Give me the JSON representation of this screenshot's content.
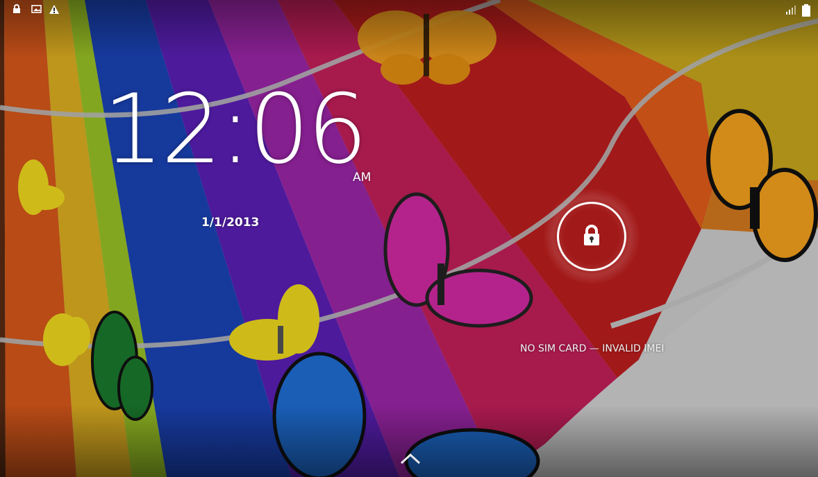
{
  "screen": {
    "name": "android-lockscreen"
  },
  "status_bar": {
    "left_icons": [
      "lock-icon",
      "image-icon",
      "warning-icon"
    ],
    "right_icons": [
      "signal-icon",
      "battery-icon"
    ]
  },
  "clock": {
    "time": "12:06",
    "ampm": "AM",
    "date": "1/1/2013"
  },
  "lock": {
    "icon": "padlock-icon"
  },
  "carrier": {
    "text": "NO SIM CARD — INVALID IMEI"
  },
  "unlock_hint": {
    "icon": "chevron-up-icon"
  },
  "theme": {
    "text_color": "#ffffff",
    "wallpaper_bg": "#d4d4d4"
  }
}
